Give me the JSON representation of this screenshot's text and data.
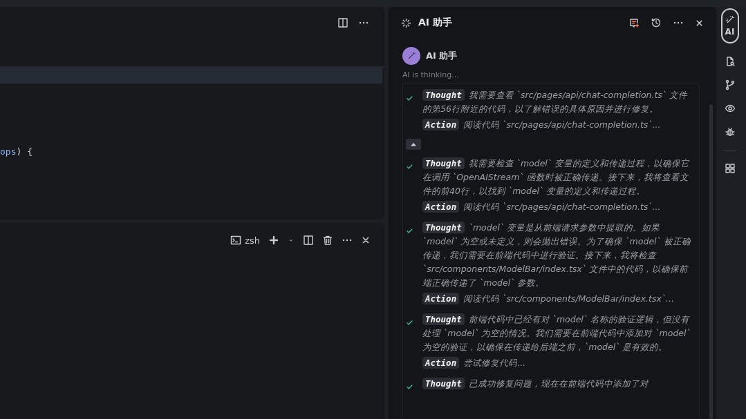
{
  "editor": {
    "code_lines": [
      {
        "tokens": [
          {
            "text": "ops",
            "kind": "param"
          },
          {
            "text": ") {",
            "kind": "punct"
          }
        ]
      }
    ]
  },
  "terminal": {
    "shell": "zsh"
  },
  "assistant": {
    "title": "AI 助手",
    "name": "AI 助手",
    "status": "AI is thinking...",
    "steps": [
      {
        "kind": "step",
        "done": true,
        "thought_label": "Thought",
        "thought": "我需要查看 `src/pages/api/chat-completion.ts` 文件的第56行附近的代码，以了解错误的具体原因并进行修复。",
        "action_label": "Action",
        "action": "阅读代码 `src/pages/api/chat-completion.ts`..."
      },
      {
        "kind": "toggle",
        "expanded": true
      },
      {
        "kind": "step",
        "done": true,
        "thought_label": "Thought",
        "thought": "我需要检查 `model` 变量的定义和传递过程，以确保它在调用 `OpenAIStream` 函数时被正确传递。接下来，我将查看文件的前40行，以找到 `model` 变量的定义和传递过程。",
        "action_label": "Action",
        "action": "阅读代码 `src/pages/api/chat-completion.ts`..."
      },
      {
        "kind": "step",
        "done": true,
        "thought_label": "Thought",
        "thought": "`model` 变量是从前端请求参数中提取的。如果 `model` 为空或未定义，则会抛出错误。为了确保 `model` 被正确传递，我们需要在前端代码中进行验证。接下来，我将检查 `src/components/ModelBar/index.tsx` 文件中的代码，以确保前端正确传递了 `model` 参数。",
        "action_label": "Action",
        "action": "阅读代码 `src/components/ModelBar/index.tsx`..."
      },
      {
        "kind": "step",
        "done": true,
        "thought_label": "Thought",
        "thought": "前端代码中已经有对 `model` 名称的验证逻辑，但没有处理 `model` 为空的情况。我们需要在前端代码中添加对 `model` 为空的验证，以确保在传递给后端之前，`model` 是有效的。",
        "action_label": "Action",
        "action": "尝试修复代码..."
      },
      {
        "kind": "step",
        "done": true,
        "thought_label": "Thought",
        "thought": "已成功修复问题，现在在前端代码中添加了对"
      }
    ]
  },
  "activity_bar": [
    {
      "kind": "ai",
      "label": "AI",
      "selected": true
    },
    {
      "kind": "file-search",
      "selected": false
    },
    {
      "kind": "branch",
      "selected": false
    },
    {
      "kind": "eye",
      "selected": false
    },
    {
      "kind": "bug",
      "selected": false
    },
    {
      "kind": "divider"
    },
    {
      "kind": "grid",
      "selected": false
    }
  ]
}
